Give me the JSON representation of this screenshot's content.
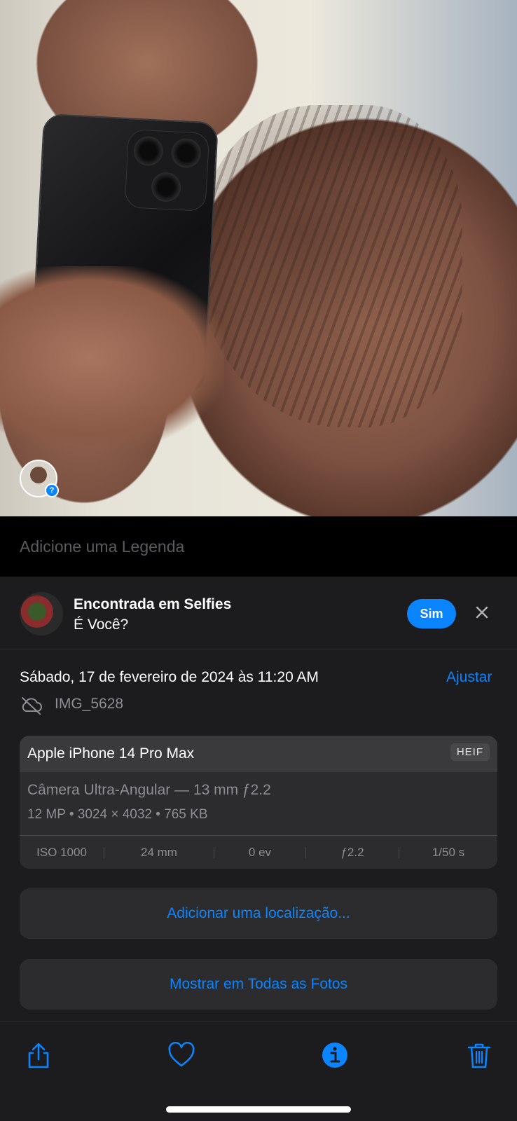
{
  "caption": {
    "placeholder": "Adicione uma Legenda"
  },
  "suggestion": {
    "title": "Encontrada em Selfies",
    "subtitle": "É Você?",
    "confirm_label": "Sim"
  },
  "info": {
    "date": "Sábado, 17 de fevereiro de 2024 às 11:20 AM",
    "adjust_label": "Ajustar",
    "filename": "IMG_5628"
  },
  "camera": {
    "model": "Apple iPhone 14 Pro Max",
    "format": "HEIF",
    "lens": "Câmera Ultra-Angular — 13 mm ƒ2.2",
    "specs": "12 MP  •  3024 × 4032  •  765 KB",
    "exif": {
      "iso": "ISO 1000",
      "focal": "24 mm",
      "ev": "0 ev",
      "aperture": "ƒ2.2",
      "shutter": "1/50 s"
    }
  },
  "actions": {
    "add_location": "Adicionar uma localização...",
    "show_all": "Mostrar em Todas as Fotos"
  },
  "toolbar": {
    "icons": [
      "share-icon",
      "heart-icon",
      "info-icon",
      "trash-icon"
    ]
  },
  "colors": {
    "accent": "#0a84ff",
    "background": "#1c1c1e",
    "card": "#2c2c2e"
  }
}
